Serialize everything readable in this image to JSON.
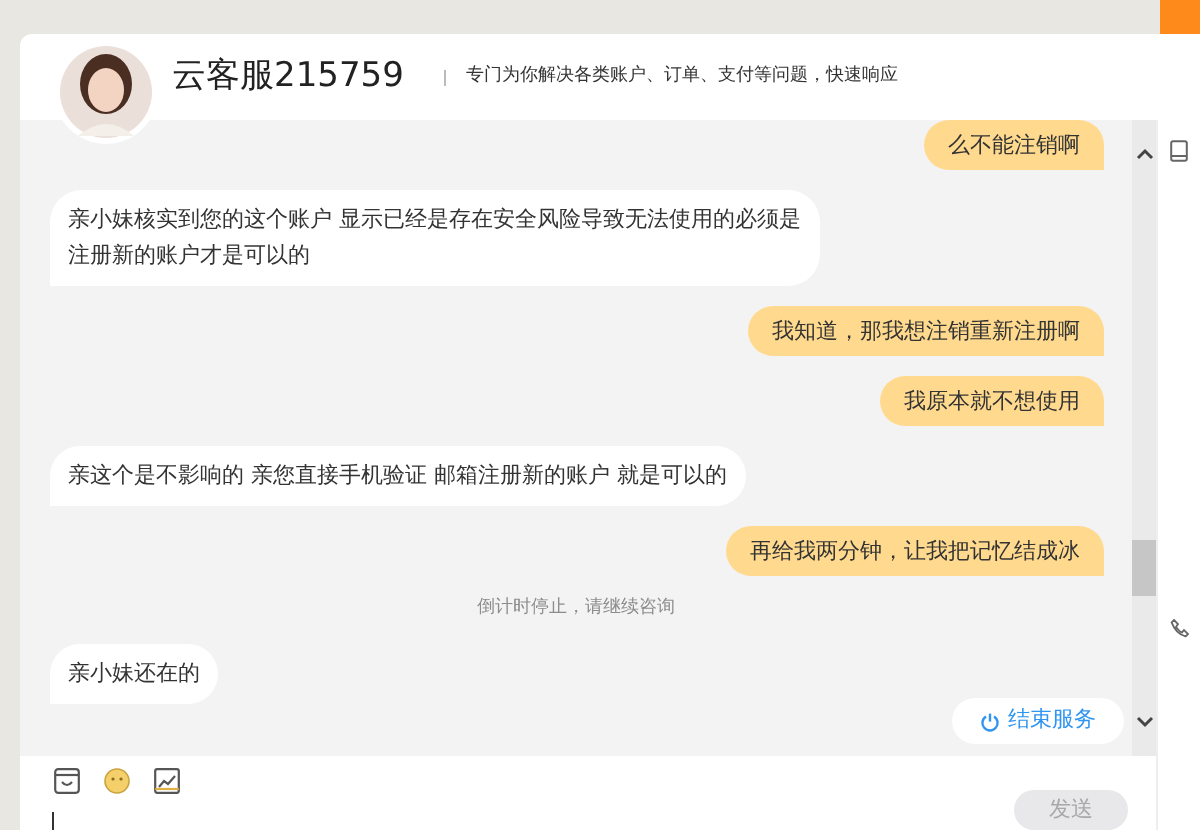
{
  "header": {
    "agent_name": "云客服215759",
    "tagline": "专门为你解决各类账户、订单、支付等问题，快速响应"
  },
  "messages": [
    {
      "kind": "sent",
      "text": "么不能注销啊"
    },
    {
      "kind": "received",
      "text": "亲小妹核实到您的这个账户 显示已经是存在安全风险导致无法使用的必须是注册新的账户才是可以的"
    },
    {
      "kind": "sent",
      "text": "我知道，那我想注销重新注册啊"
    },
    {
      "kind": "sent",
      "text": "我原本就不想使用"
    },
    {
      "kind": "received",
      "text": "亲这个是不影响的 亲您直接手机验证 邮箱注册新的账户 就是可以的"
    },
    {
      "kind": "sent",
      "text": "再给我两分钟，让我把记忆结成冰"
    },
    {
      "kind": "notice",
      "text": "倒计时停止，请继续咨询"
    },
    {
      "kind": "received",
      "text": "亲小妹还在的"
    }
  ],
  "end_button": "结束服务",
  "send_button": {
    "label": "发送",
    "disabled": true
  }
}
